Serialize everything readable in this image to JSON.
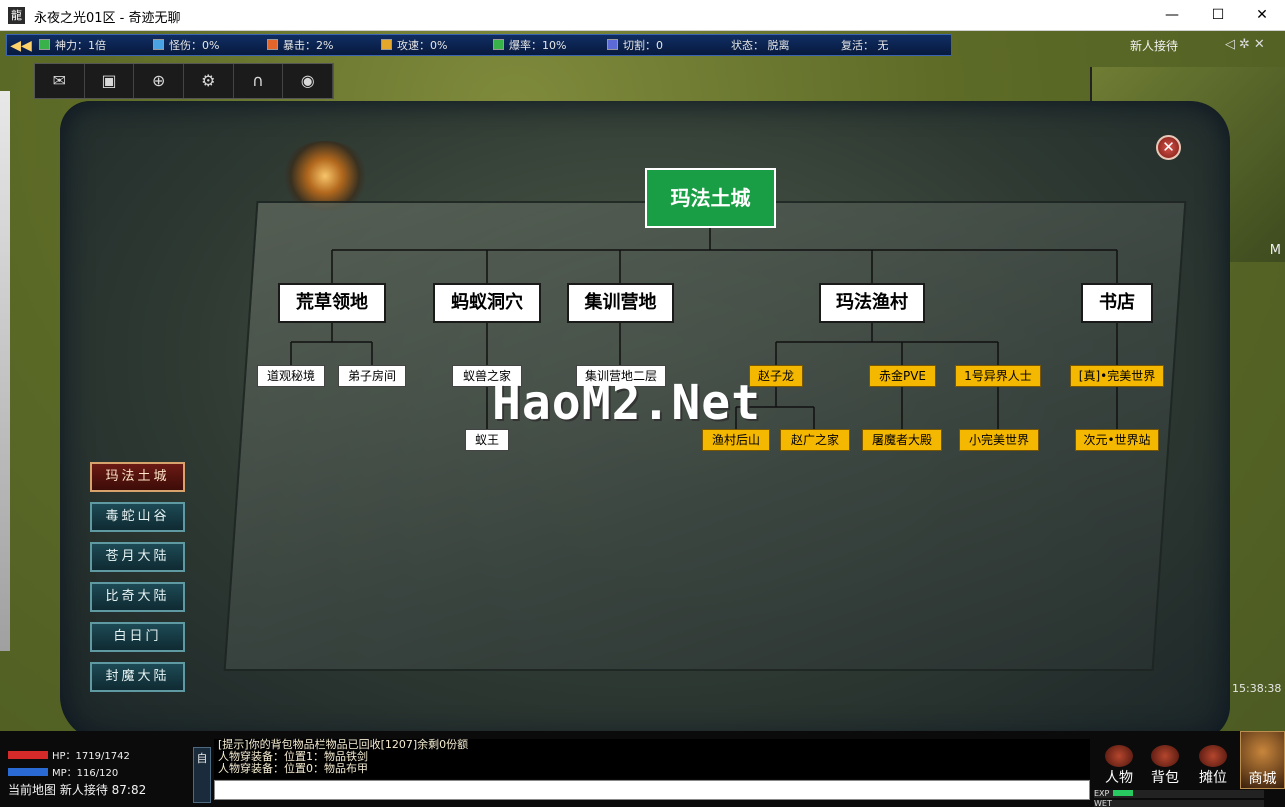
{
  "window": {
    "title": "永夜之光01区 - 奇迹无聊",
    "app_icon": "龍",
    "minimize": "—",
    "maximize": "☐",
    "close": "✕"
  },
  "topbar": {
    "stats": [
      {
        "label": "神力：1倍",
        "color": "#3ab24a"
      },
      {
        "label": "怪伤：0%",
        "color": "#4aa3e3"
      },
      {
        "label": "暴击：2%",
        "color": "#e2662c"
      },
      {
        "label": "攻速：0%",
        "color": "#e6a82a"
      },
      {
        "label": "爆率：10%",
        "color": "#3ab24a"
      },
      {
        "label": "切割：0",
        "color": "#5b6ad6"
      }
    ],
    "status": "状态： 脱离",
    "revive": "复活： 无",
    "npc_name": "新人接待",
    "icons": [
      "sound-icon",
      "gear-icon",
      "close-icon"
    ]
  },
  "iconbar": [
    "mail-icon",
    "image-icon",
    "gamepad-icon",
    "group-icon",
    "headset-icon",
    "globe-icon"
  ],
  "minimap": {
    "label": "M"
  },
  "tree": {
    "root": "玛法土城",
    "areas": [
      {
        "name": "荒草领地",
        "children": [
          "道观秘境",
          "弟子房间"
        ]
      },
      {
        "name": "蚂蚁洞穴",
        "children": [
          "蚁兽之家",
          "蚁王"
        ]
      },
      {
        "name": "集训营地",
        "children": [
          "集训营地二层"
        ]
      },
      {
        "name": "玛法渔村",
        "children": [
          "赵子龙",
          "渔村后山",
          "赵广之家",
          "赤金PVE",
          "屠魔者大殿",
          "1号异界人士",
          "小完美世界"
        ]
      },
      {
        "name": "书店",
        "children": [
          "[真]•完美世界",
          "次元•世界站"
        ]
      }
    ]
  },
  "watermark": "HaoM2.Net",
  "regions": [
    "玛法土城",
    "毒蛇山谷",
    "苍月大陆",
    "比奇大陆",
    "白日门",
    "封魔大陆"
  ],
  "active_region": "玛法土城",
  "clock": "15:38:38",
  "hud": {
    "hp": "HP：1719/1742",
    "mp": "MP：116/120",
    "hp_fraction": 0.99,
    "mp_fraction": 0.97,
    "current_map_label": "当前地图",
    "current_map": "新人接待 87:82",
    "auto_label": "自",
    "chat_lines": [
      "[提示]你的背包物品栏物品已回收[1207]余剩0份额",
      "人物穿装备：位置1：物品铁剑",
      "人物穿装备：位置0：物品布甲"
    ],
    "buttons": [
      "人物",
      "背包",
      "摊位"
    ],
    "shop": "商城",
    "exp_label": "EXP",
    "wet_label": "WET"
  }
}
